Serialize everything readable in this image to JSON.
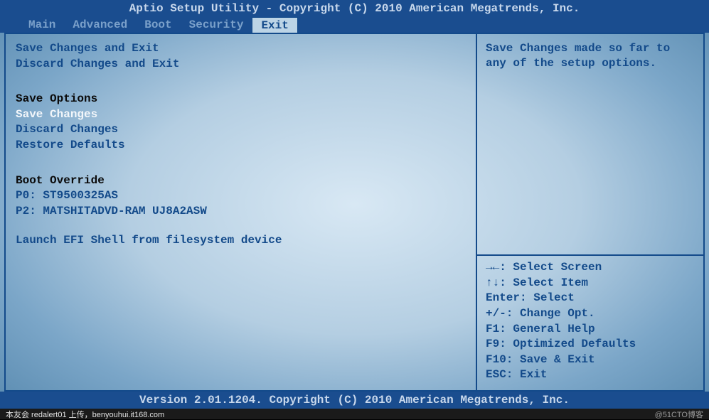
{
  "title_bar": "Aptio Setup Utility - Copyright (C) 2010 American Megatrends, Inc.",
  "tabs": {
    "main": "Main",
    "advanced": "Advanced",
    "boot": "Boot",
    "security": "Security",
    "exit": "Exit"
  },
  "menu": {
    "save_exit": "Save Changes and Exit",
    "discard_exit": "Discard Changes and Exit",
    "save_options_header": "Save Options",
    "save_changes": "Save Changes",
    "discard_changes": "Discard Changes",
    "restore_defaults": "Restore Defaults",
    "boot_override_header": "Boot Override",
    "boot_p0": "P0: ST9500325AS",
    "boot_p2": "P2: MATSHITADVD-RAM UJ8A2ASW",
    "launch_efi": "Launch EFI Shell from filesystem device"
  },
  "help": {
    "description": "Save Changes made so far to any of the setup options.",
    "keys": {
      "select_screen": "→←: Select Screen",
      "select_item": "↑↓: Select Item",
      "enter": "Enter: Select",
      "change_opt": "+/-: Change Opt.",
      "f1": "F1: General Help",
      "f9": "F9: Optimized Defaults",
      "f10": "F10: Save & Exit",
      "esc": "ESC: Exit"
    }
  },
  "footer_bar": "Version 2.01.1204. Copyright (C) 2010 American Megatrends, Inc.",
  "bottom": {
    "left": "本友会 redalert01 上传，benyouhui.it168.com",
    "right": "@51CTO博客"
  }
}
